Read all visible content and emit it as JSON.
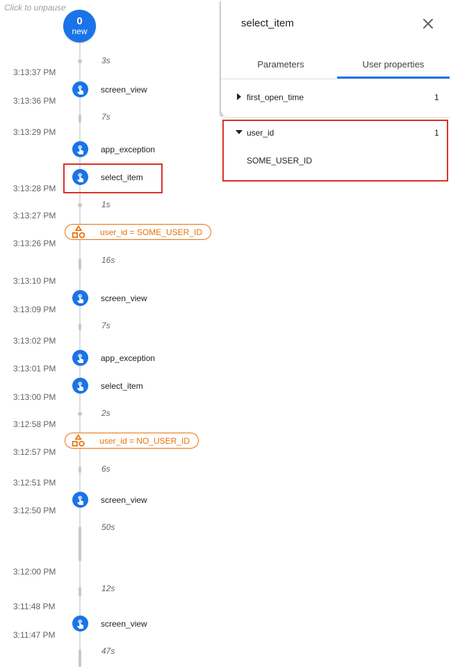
{
  "header": {
    "unpause_hint": "Click to unpause"
  },
  "new_badge": {
    "count": "0",
    "label": "new"
  },
  "timeline": {
    "times": [
      "3:13:37 PM",
      "3:13:36 PM",
      "3:13:29 PM",
      "3:13:28 PM",
      "3:13:27 PM",
      "3:13:26 PM",
      "3:13:10 PM",
      "3:13:09 PM",
      "3:13:02 PM",
      "3:13:01 PM",
      "3:13:00 PM",
      "3:12:58 PM",
      "3:12:57 PM",
      "3:12:51 PM",
      "3:12:50 PM",
      "3:12:00 PM",
      "3:11:48 PM",
      "3:11:47 PM"
    ],
    "gaps": [
      "3s",
      "7s",
      "1s",
      "16s",
      "7s",
      "2s",
      "6s",
      "50s",
      "12s",
      "47s"
    ],
    "events": [
      "screen_view",
      "app_exception",
      "select_item",
      "screen_view",
      "app_exception",
      "select_item",
      "screen_view",
      "screen_view"
    ],
    "property_changes": [
      "user_id = SOME_USER_ID",
      "user_id = NO_USER_ID"
    ]
  },
  "detail_panel": {
    "title": "select_item",
    "tabs": [
      "Parameters",
      "User properties"
    ],
    "active_tab": "User properties",
    "properties": [
      {
        "name": "first_open_time",
        "count": "1",
        "expanded": false
      },
      {
        "name": "user_id",
        "count": "1",
        "expanded": true,
        "value": "SOME_USER_ID"
      }
    ]
  },
  "colors": {
    "accent": "#1a73e8",
    "property": "#e8710a",
    "highlight": "#d93025"
  }
}
